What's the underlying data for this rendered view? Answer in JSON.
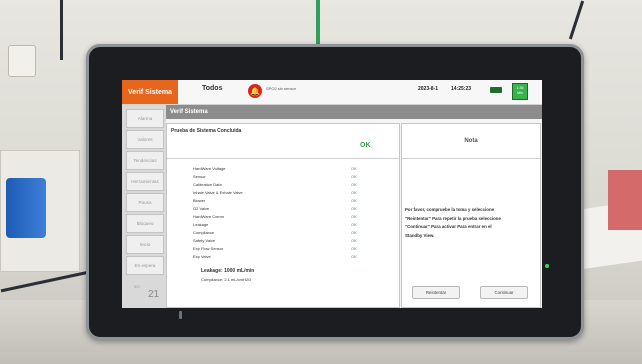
{
  "header": {
    "mode_tab": "Verif Sistema",
    "patient_label": "Todos",
    "alarm_icon": "bell-icon",
    "alarm_message": "SPO2 sin sensor",
    "date": "2023-8-1",
    "time": "14:25:23",
    "power_icon": "plug-icon",
    "battery_lines": [
      "1:36",
      "Min"
    ]
  },
  "sidebar": {
    "items": [
      {
        "label": "Alarma"
      },
      {
        "label": "Valores"
      },
      {
        "label": "Tendencias"
      },
      {
        "label": "Herramientas"
      },
      {
        "label": "Pausa"
      },
      {
        "label": "Bloqueo"
      },
      {
        "label": "Inicio"
      },
      {
        "label": "En espera"
      }
    ],
    "counter_small": "5/0",
    "counter": "21"
  },
  "section_title": "Verif Sistema",
  "test": {
    "title": "Prueba de Sistema Concluida",
    "result": "OK",
    "checks": [
      {
        "name": "HardWare Voltage",
        "status": "OK"
      },
      {
        "name": "Sensor",
        "status": "OK"
      },
      {
        "name": "Calibration Data",
        "status": "OK"
      },
      {
        "name": "Inhale Valve & Exhale Valve",
        "status": "OK"
      },
      {
        "name": "Blower",
        "status": "OK"
      },
      {
        "name": "O2 Valve",
        "status": "OK"
      },
      {
        "name": "HardWare Comm",
        "status": "OK"
      },
      {
        "name": "Leakage",
        "status": "OK"
      },
      {
        "name": "Compliance",
        "status": "OK"
      },
      {
        "name": "Safety Valve",
        "status": "OK"
      },
      {
        "name": "Exp Flow Sensor",
        "status": "OK"
      },
      {
        "name": "Exp Valve",
        "status": "OK"
      }
    ],
    "leakage_text": "Leakage: 1000 mL/min",
    "compliance_text": "Compliance: 2.1 mL/cmH2O"
  },
  "note": {
    "title": "Nota",
    "lines": [
      "Por favor, compruebe la toma y seleccione",
      "\"Reintentar\" Para repetir la prueba seleccione",
      "\"Continuar\" Para activar Para entrar en el",
      "Standby View."
    ]
  },
  "buttons": {
    "retry": "Reintentar",
    "continue": "Continuar"
  },
  "colors": {
    "mode_tab": "#e8651e",
    "ok_green": "#3aa04a",
    "alarm_red": "#d8261c",
    "header_strip": "#8c8c8c"
  }
}
